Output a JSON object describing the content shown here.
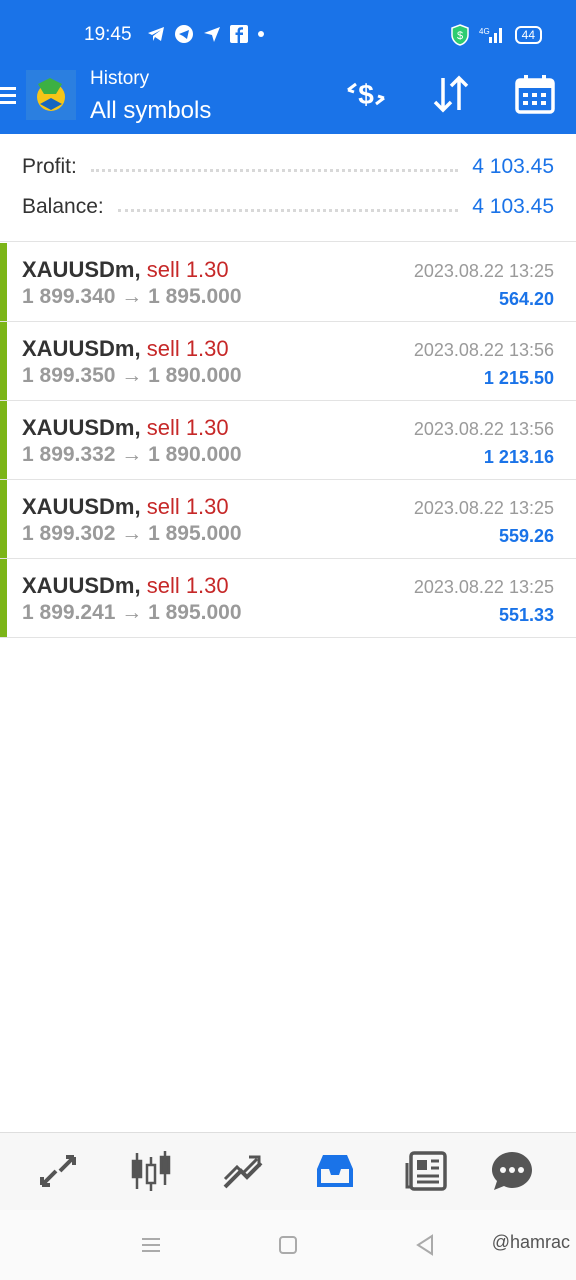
{
  "status": {
    "time": "19:45",
    "battery": "44"
  },
  "header": {
    "title": "History",
    "subtitle": "All symbols"
  },
  "summary": {
    "profit_label": "Profit:",
    "profit_value": "4 103.45",
    "balance_label": "Balance:",
    "balance_value": "4 103.45"
  },
  "deals": [
    {
      "symbol": "XAUUSDm,",
      "type": "sell 1.30",
      "prices": "1 899.340 → 1 895.000",
      "date": "2023.08.22 13:25",
      "profit": "564.20"
    },
    {
      "symbol": "XAUUSDm,",
      "type": "sell 1.30",
      "prices": "1 899.350 → 1 890.000",
      "date": "2023.08.22 13:56",
      "profit": "1 215.50"
    },
    {
      "symbol": "XAUUSDm,",
      "type": "sell 1.30",
      "prices": "1 899.332 → 1 890.000",
      "date": "2023.08.22 13:56",
      "profit": "1 213.16"
    },
    {
      "symbol": "XAUUSDm,",
      "type": "sell 1.30",
      "prices": "1 899.302 → 1 895.000",
      "date": "2023.08.22 13:25",
      "profit": "559.26"
    },
    {
      "symbol": "XAUUSDm,",
      "type": "sell 1.30",
      "prices": "1 899.241 → 1 895.000",
      "date": "2023.08.22 13:25",
      "profit": "551.33"
    }
  ],
  "tabs": [
    "quotes-icon",
    "chart-icon",
    "trade-icon",
    "history-icon",
    "news-icon",
    "messages-icon"
  ],
  "colors": {
    "accent": "#1a73e8",
    "sell": "#c62828",
    "profit_bar": "#7cb518"
  },
  "watermark": "@hamrac"
}
